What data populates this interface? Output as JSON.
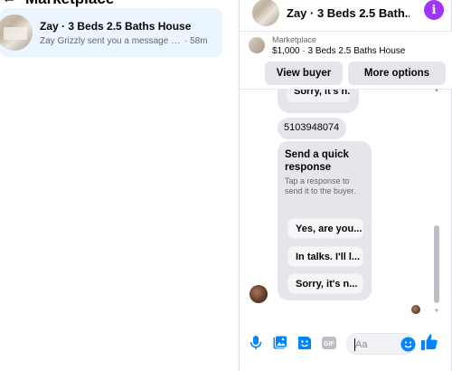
{
  "left_panel": {
    "header_title": "Marketplace",
    "back_glyph": "←",
    "conversation": {
      "title": "Zay · 3 Beds 2.5 Baths House",
      "preview": "Zay Grizzly sent you a message abo...",
      "time": "· 58m"
    }
  },
  "chat": {
    "header": {
      "title": "Zay · 3 Beds 2.5 Bath...",
      "info_icon": "info-icon",
      "info_glyph": "i",
      "accent": "#a033ff"
    },
    "marketplace_bar": {
      "label": "Marketplace",
      "listing": "$1,000 · 3 Beds 2.5 Baths House",
      "buttons": {
        "view_buyer": "View buyer",
        "more_options": "More options"
      }
    },
    "messages": {
      "top_chip": "Sorry, it's n...",
      "phone": "5103948074",
      "quick_response": {
        "title": "Send a quick response",
        "description": "Tap a response to send it to the buyer.",
        "replies": [
          "Yes, are you...",
          "In talks. I'll l...",
          "Sorry, it's n..."
        ]
      }
    },
    "composer": {
      "icons": [
        "microphone-icon",
        "photo-icon",
        "sticker-icon",
        "gif-icon"
      ],
      "input_placeholder": "Aa",
      "emoji_icon": "emoji-icon",
      "like_icon": "thumbs-up-icon",
      "accent": "#0084ff"
    }
  }
}
